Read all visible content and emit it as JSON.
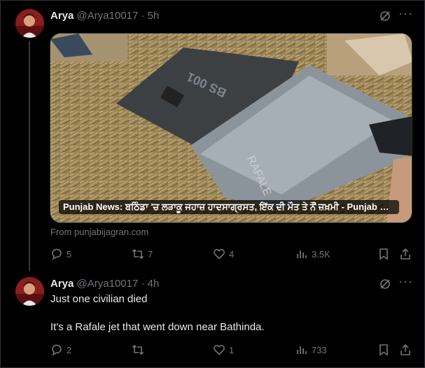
{
  "tweets": [
    {
      "author": "Arya",
      "handle": "@Arya10017",
      "time": "5h",
      "card": {
        "title": "Punjab News: ਬਠਿੰਡਾ 'ਚ ਲੜਾਕੂ ਜਹਾਜ਼ ਹਾਦਸਾਗ੍ਰਸਤ, ਇੱਕ ਦੀ ਮੌਤ ਤੇ ਨੌਂ ਜ਼ਖ਼ਮੀ - Punjab New...",
        "source": "From punjabijagran.com",
        "wreck_marking_1": "BS 001",
        "wreck_marking_2": "RAFALE"
      },
      "stats": {
        "replies": "5",
        "reposts": "7",
        "likes": "4",
        "views": "3.5K"
      }
    },
    {
      "author": "Arya",
      "handle": "@Arya10017",
      "time": "4h",
      "text_line1": "Just one civilian died",
      "text_line2": "It's a Rafale jet that went down near Bathinda.",
      "stats": {
        "replies": "2",
        "reposts": "",
        "likes": "1",
        "views": "733"
      }
    }
  ],
  "separator": "·",
  "icons": [
    "grok-icon",
    "more-icon",
    "reply-icon",
    "repost-icon",
    "like-icon",
    "views-icon",
    "bookmark-icon",
    "share-icon"
  ],
  "colors": {
    "background": "#000000",
    "text": "#e7e9ea",
    "muted": "#71767b",
    "border": "#2f3336"
  }
}
